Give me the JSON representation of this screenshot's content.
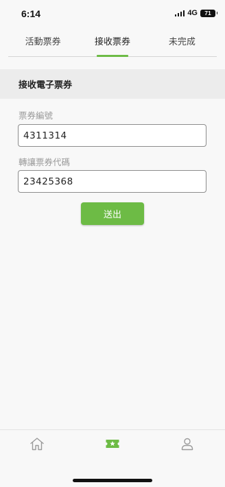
{
  "status_bar": {
    "time": "6:14",
    "network": "4G",
    "battery": "71",
    "icons": [
      "signal-icon",
      "battery-icon"
    ]
  },
  "tabs": [
    {
      "label": "活動票券",
      "active": false
    },
    {
      "label": "接收票券",
      "active": true
    },
    {
      "label": "未完成",
      "active": false
    }
  ],
  "section": {
    "title": "接收電子票券"
  },
  "form": {
    "ticket_number_label": "票券編號",
    "ticket_number_value": "4311314",
    "transfer_code_label": "轉讓票券代碼",
    "transfer_code_value": "23425368",
    "submit_label": "送出"
  },
  "bottom_nav": {
    "items": [
      {
        "icon": "home-icon",
        "active": false
      },
      {
        "icon": "ticket-star-icon",
        "active": true
      },
      {
        "icon": "user-icon",
        "active": false
      }
    ]
  },
  "colors": {
    "accent": "#6dbb45",
    "background": "#f8f8f8",
    "section_background": "#ececec",
    "label_gray": "#9a9a9a"
  }
}
